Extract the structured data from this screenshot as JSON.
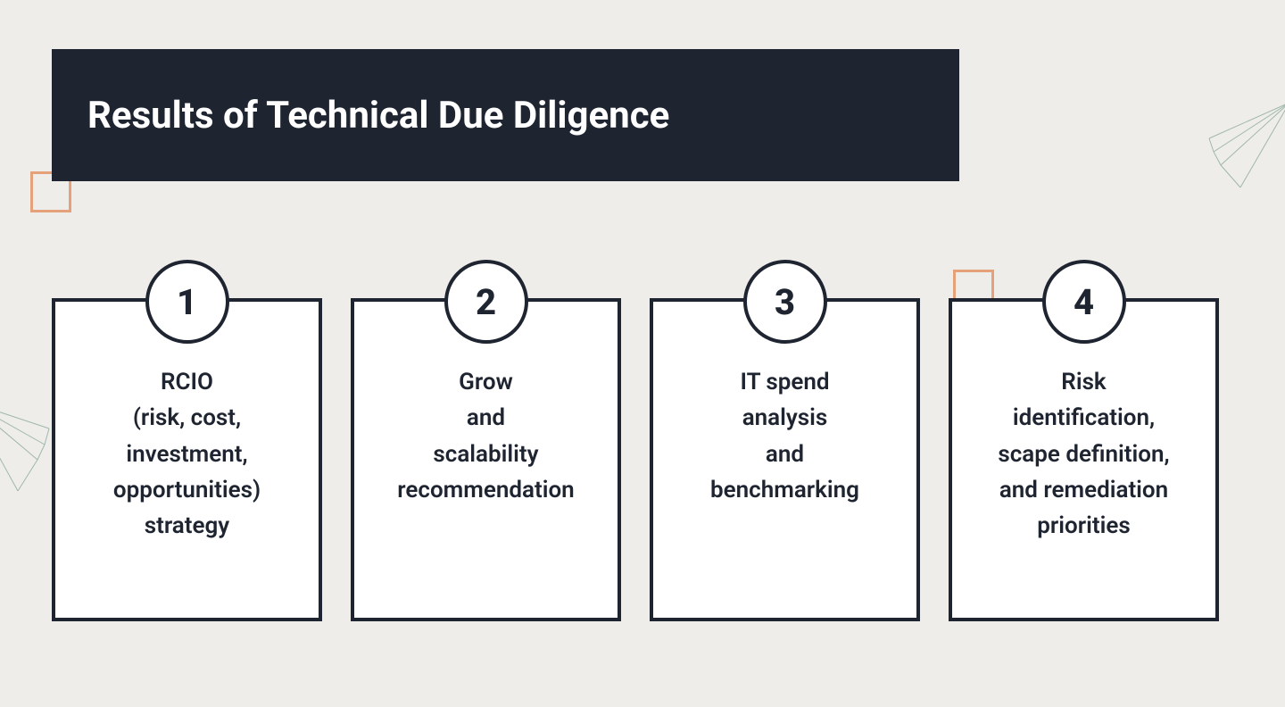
{
  "title": "Results of Technical Due Diligence",
  "cards": [
    {
      "num": "1",
      "text": "RCIO\n(risk, cost,\ninvestment,\nopportunities)\nstrategy"
    },
    {
      "num": "2",
      "text": "Grow\nand\nscalability\nrecommendation"
    },
    {
      "num": "3",
      "text": "IT spend\nanalysis\nand\nbenchmarking"
    },
    {
      "num": "4",
      "text": "Risk\nidentification,\nscape definition,\nand remediation\npriorities"
    }
  ]
}
